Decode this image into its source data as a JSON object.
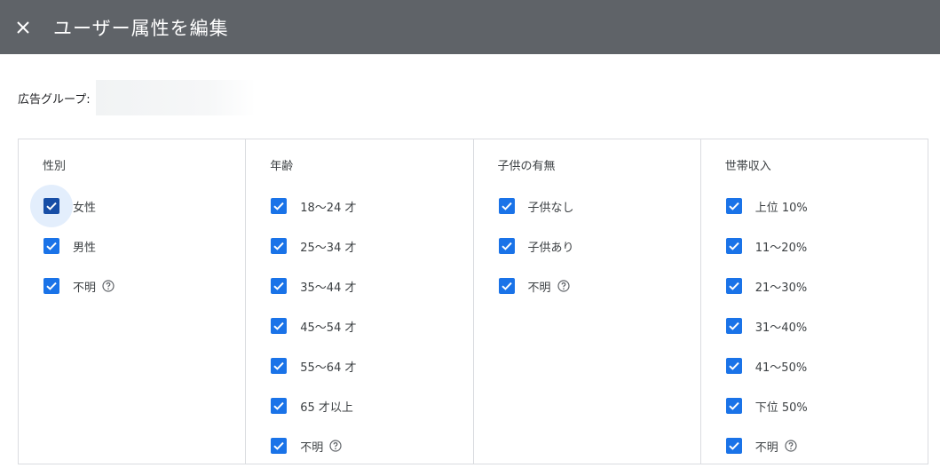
{
  "header": {
    "title": "ユーザー属性を編集",
    "close_icon": "close-icon"
  },
  "ad_group": {
    "label": "広告グループ:",
    "value": ""
  },
  "columns": [
    {
      "title": "性別",
      "options": [
        {
          "label": "女性",
          "checked": true,
          "focused": true
        },
        {
          "label": "男性",
          "checked": true
        },
        {
          "label": "不明",
          "checked": true,
          "help": true
        }
      ]
    },
    {
      "title": "年齢",
      "options": [
        {
          "label": "18～24 才",
          "checked": true
        },
        {
          "label": "25～34 才",
          "checked": true
        },
        {
          "label": "35～44 才",
          "checked": true
        },
        {
          "label": "45～54 才",
          "checked": true
        },
        {
          "label": "55～64 才",
          "checked": true
        },
        {
          "label": "65 才以上",
          "checked": true
        },
        {
          "label": "不明",
          "checked": true,
          "help": true
        }
      ]
    },
    {
      "title": "子供の有無",
      "options": [
        {
          "label": "子供なし",
          "checked": true
        },
        {
          "label": "子供あり",
          "checked": true
        },
        {
          "label": "不明",
          "checked": true,
          "help": true
        }
      ]
    },
    {
      "title": "世帯収入",
      "options": [
        {
          "label": "上位 10%",
          "checked": true
        },
        {
          "label": "11～20%",
          "checked": true
        },
        {
          "label": "21～30%",
          "checked": true
        },
        {
          "label": "31～40%",
          "checked": true
        },
        {
          "label": "41～50%",
          "checked": true
        },
        {
          "label": "下位 50%",
          "checked": true
        },
        {
          "label": "不明",
          "checked": true,
          "help": true
        }
      ]
    }
  ],
  "colors": {
    "header_bg": "#5f6368",
    "checkbox": "#1a73e8",
    "checkbox_focused": "#174ea6",
    "border": "#dadce0"
  }
}
